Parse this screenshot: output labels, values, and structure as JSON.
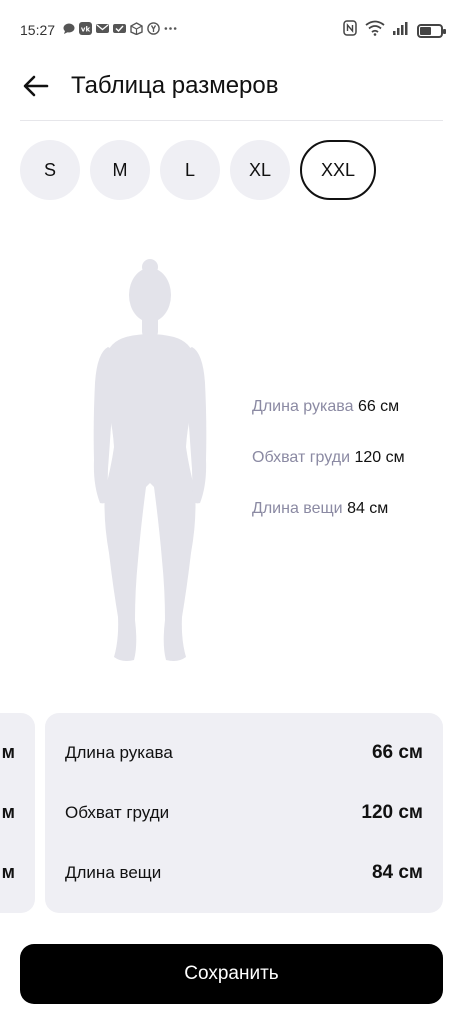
{
  "status_bar": {
    "time": "15:27",
    "left_icons": [
      "chat-bubble-icon",
      "vk-icon",
      "mail-icon",
      "mail-check-icon",
      "box-icon",
      "yandex-icon",
      "more-dots-icon"
    ],
    "right_icons": [
      "nfc-icon",
      "wifi-icon",
      "signal-icon",
      "battery-icon"
    ],
    "battery_level": 0.5
  },
  "header": {
    "title": "Таблица размеров"
  },
  "sizes": {
    "options": [
      "S",
      "M",
      "L",
      "XL",
      "XXL"
    ],
    "selected": "XXL"
  },
  "figure_measurements": [
    {
      "name": "Длина рукава",
      "value": "66 см"
    },
    {
      "name": "Обхват груди",
      "value": "120 см"
    },
    {
      "name": "Длина вещи",
      "value": "84 см"
    }
  ],
  "card_previous_fragments": [
    "м",
    "м",
    "м"
  ],
  "card": {
    "rows": [
      {
        "label": "Длина рукава",
        "value": "66 см"
      },
      {
        "label": "Обхват груди",
        "value": "120 см"
      },
      {
        "label": "Длина вещи",
        "value": "84 см"
      }
    ]
  },
  "save_label": "Сохранить",
  "colors": {
    "chip_bg": "#efeff4",
    "figure": "#e3e3ea",
    "muted_label": "#8b8aa3",
    "button_bg": "#000000"
  }
}
